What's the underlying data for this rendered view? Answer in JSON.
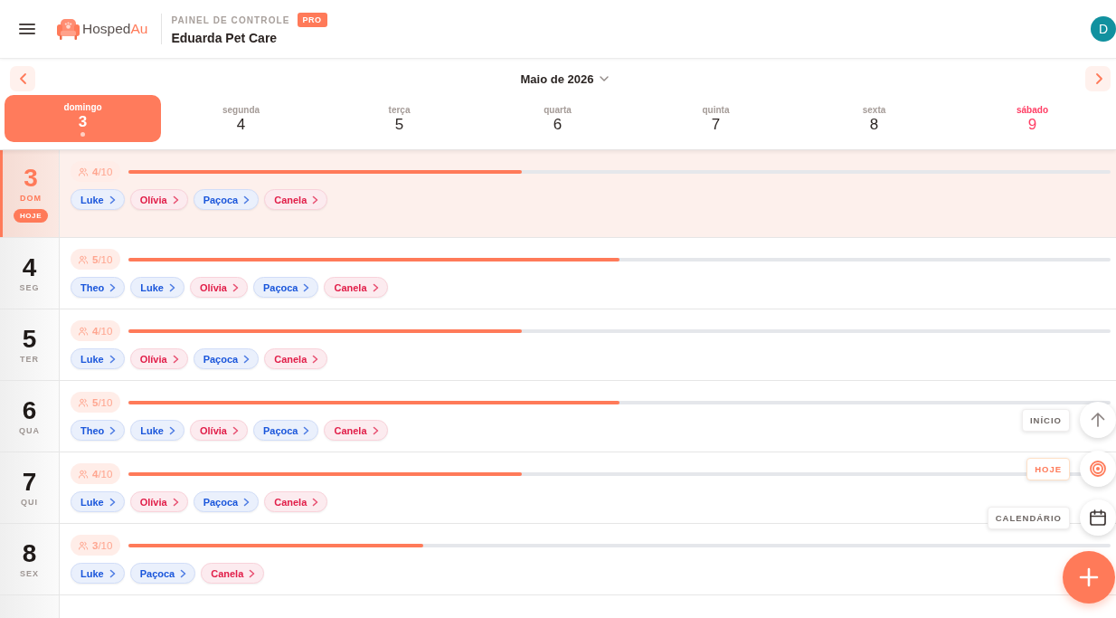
{
  "header": {
    "brand_name": "Hosped",
    "brand_accent": "Au",
    "section_label": "PAINEL DE CONTROLE",
    "plan_badge": "PRO",
    "business_name": "Eduarda Pet Care",
    "avatar_initial": "D"
  },
  "week_nav": {
    "month_label": "Maio de 2026",
    "days": [
      {
        "name": "domingo",
        "number": "3",
        "selected": true,
        "today": true,
        "highlight": false
      },
      {
        "name": "segunda",
        "number": "4",
        "selected": false,
        "today": false,
        "highlight": false
      },
      {
        "name": "terça",
        "number": "5",
        "selected": false,
        "today": false,
        "highlight": false
      },
      {
        "name": "quarta",
        "number": "6",
        "selected": false,
        "today": false,
        "highlight": false
      },
      {
        "name": "quinta",
        "number": "7",
        "selected": false,
        "today": false,
        "highlight": false
      },
      {
        "name": "sexta",
        "number": "8",
        "selected": false,
        "today": false,
        "highlight": false
      },
      {
        "name": "sábado",
        "number": "9",
        "selected": false,
        "today": false,
        "highlight": true
      }
    ]
  },
  "agenda": [
    {
      "number": "3",
      "weekday": "DOM",
      "today": true,
      "today_label": "HOJE",
      "occupancy": "**4**/10",
      "level": 0.4,
      "pets": [
        {
          "name": "Luke",
          "color": "#1a56db"
        },
        {
          "name": "Olívia",
          "color": "#e11d48"
        },
        {
          "name": "Paçoca",
          "color": "#1a56db"
        },
        {
          "name": "Canela",
          "color": "#e11d48"
        }
      ]
    },
    {
      "number": "4",
      "weekday": "SEG",
      "today": false,
      "occupancy": "**5**/10",
      "level": 0.5,
      "pets": [
        {
          "name": "Theo",
          "color": "#1a56db"
        },
        {
          "name": "Luke",
          "color": "#1a56db"
        },
        {
          "name": "Olívia",
          "color": "#e11d48"
        },
        {
          "name": "Paçoca",
          "color": "#1a56db"
        },
        {
          "name": "Canela",
          "color": "#e11d48"
        }
      ]
    },
    {
      "number": "5",
      "weekday": "TER",
      "today": false,
      "occupancy": "**4**/10",
      "level": 0.4,
      "pets": [
        {
          "name": "Luke",
          "color": "#1a56db"
        },
        {
          "name": "Olívia",
          "color": "#e11d48"
        },
        {
          "name": "Paçoca",
          "color": "#1a56db"
        },
        {
          "name": "Canela",
          "color": "#e11d48"
        }
      ]
    },
    {
      "number": "6",
      "weekday": "QUA",
      "today": false,
      "occupancy": "**5**/10",
      "level": 0.5,
      "pets": [
        {
          "name": "Theo",
          "color": "#1a56db"
        },
        {
          "name": "Luke",
          "color": "#1a56db"
        },
        {
          "name": "Olívia",
          "color": "#e11d48"
        },
        {
          "name": "Paçoca",
          "color": "#1a56db"
        },
        {
          "name": "Canela",
          "color": "#e11d48"
        }
      ]
    },
    {
      "number": "7",
      "weekday": "QUI",
      "today": false,
      "occupancy": "**4**/10",
      "level": 0.4,
      "pets": [
        {
          "name": "Luke",
          "color": "#1a56db"
        },
        {
          "name": "Olívia",
          "color": "#e11d48"
        },
        {
          "name": "Paçoca",
          "color": "#1a56db"
        },
        {
          "name": "Canela",
          "color": "#e11d48"
        }
      ]
    },
    {
      "number": "8",
      "weekday": "SEX",
      "today": false,
      "occupancy": "**3**/10",
      "level": 0.3,
      "pets": [
        {
          "name": "Luke",
          "color": "#1a56db"
        },
        {
          "name": "Paçoca",
          "color": "#1a56db"
        },
        {
          "name": "Canela",
          "color": "#e11d48"
        }
      ]
    }
  ],
  "floating_actions": [
    {
      "kind": "top",
      "label": "INÍCIO",
      "highlighted": false
    },
    {
      "kind": "today",
      "label": "HOJE",
      "highlighted": true
    },
    {
      "kind": "calendar",
      "label": "CALENDÁRIO",
      "highlighted": false
    }
  ]
}
